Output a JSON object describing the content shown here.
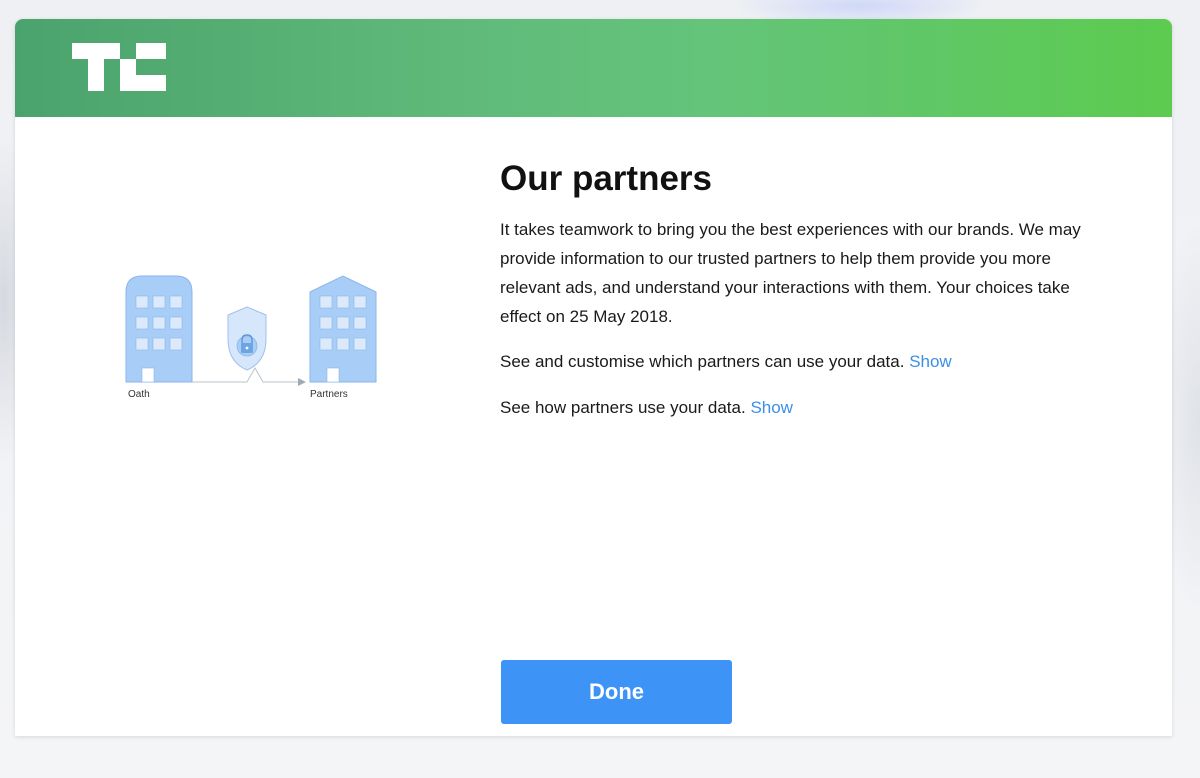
{
  "header": {
    "logo_icon": "techcrunch-logo-icon",
    "gradient_start": "#4aa36d",
    "gradient_end": "#5ccb4f"
  },
  "illustration": {
    "left_label": "Oath",
    "right_label": "Partners",
    "icons": [
      "building-icon",
      "shield-lock-icon",
      "building-icon"
    ]
  },
  "content": {
    "title": "Our partners",
    "intro": "It takes teamwork to bring you the best experiences with our brands. We may provide information to our trusted partners to help them provide you more relevant ads, and understand your interactions with them. Your choices take effect on 25 May 2018.",
    "customise_text": "See and customise which partners can use your data.",
    "customise_link": "Show",
    "usage_text": "See how partners use your data.",
    "usage_link": "Show",
    "link_color": "#3b8fe8"
  },
  "footer": {
    "done_label": "Done",
    "button_color": "#3d93f6"
  }
}
